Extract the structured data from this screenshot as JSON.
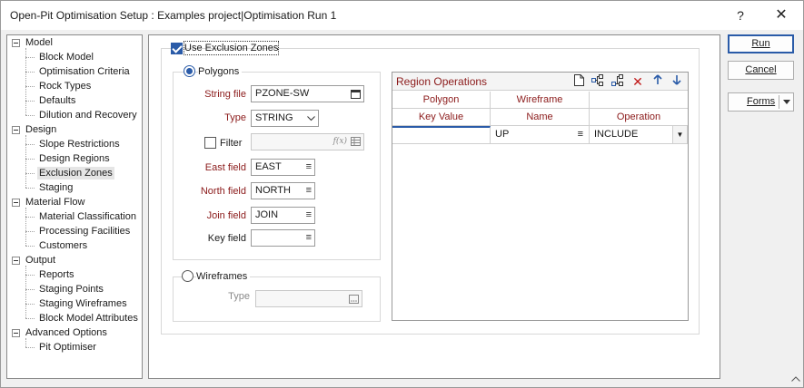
{
  "window": {
    "title": "Open-Pit Optimisation Setup : Examples project|Optimisation Run 1",
    "help_glyph": "?",
    "close_glyph": "✕"
  },
  "tree": {
    "categories": [
      {
        "label": "Model",
        "items": [
          "Block Model",
          "Optimisation Criteria",
          "Rock Types",
          "Defaults",
          "Dilution and Recovery"
        ]
      },
      {
        "label": "Design",
        "items": [
          "Slope Restrictions",
          "Design Regions",
          "Exclusion Zones",
          "Staging"
        ]
      },
      {
        "label": "Material Flow",
        "items": [
          "Material Classification",
          "Processing Facilities",
          "Customers"
        ]
      },
      {
        "label": "Output",
        "items": [
          "Reports",
          "Staging Points",
          "Staging Wireframes",
          "Block Model Attributes"
        ]
      },
      {
        "label": "Advanced Options",
        "items": [
          "Pit Optimiser"
        ]
      }
    ],
    "selected": "Exclusion Zones"
  },
  "form": {
    "use_exclusion_zones": {
      "label": "Use Exclusion Zones",
      "checked": true
    },
    "polygons": {
      "radio_label": "Polygons",
      "selected": true,
      "string_file": {
        "label": "String file",
        "value": "PZONE-SW",
        "icon": "calendar-icon"
      },
      "type": {
        "label": "Type",
        "value": "STRING"
      },
      "filter": {
        "label": "Filter",
        "checked": false,
        "value": "",
        "fx_glyph": "f(x)"
      },
      "east_field": {
        "label": "East field",
        "value": "EAST"
      },
      "north_field": {
        "label": "North field",
        "value": "NORTH"
      },
      "join_field": {
        "label": "Join field",
        "value": "JOIN"
      },
      "key_field": {
        "label": "Key field",
        "value": ""
      }
    },
    "wireframes": {
      "radio_label": "Wireframes",
      "selected": false,
      "type": {
        "label": "Type",
        "value": ""
      }
    }
  },
  "region_operations": {
    "title": "Region Operations",
    "groups": [
      "Polygon",
      "Wireframe"
    ],
    "columns": [
      "Key Value",
      "Name",
      "Operation"
    ],
    "rows": [
      {
        "key_value": "",
        "name": "UP",
        "operation": "INCLUDE"
      }
    ],
    "toolbar": [
      "new-icon",
      "insert-icon",
      "append-icon",
      "delete-icon",
      "move-up-icon",
      "move-down-icon"
    ]
  },
  "buttons": {
    "run": "Run",
    "cancel": "Cancel",
    "forms": "Forms"
  },
  "colors": {
    "label_red": "#8b1a1a",
    "accent_blue": "#2a5ba8",
    "delete_red": "#c01818"
  }
}
